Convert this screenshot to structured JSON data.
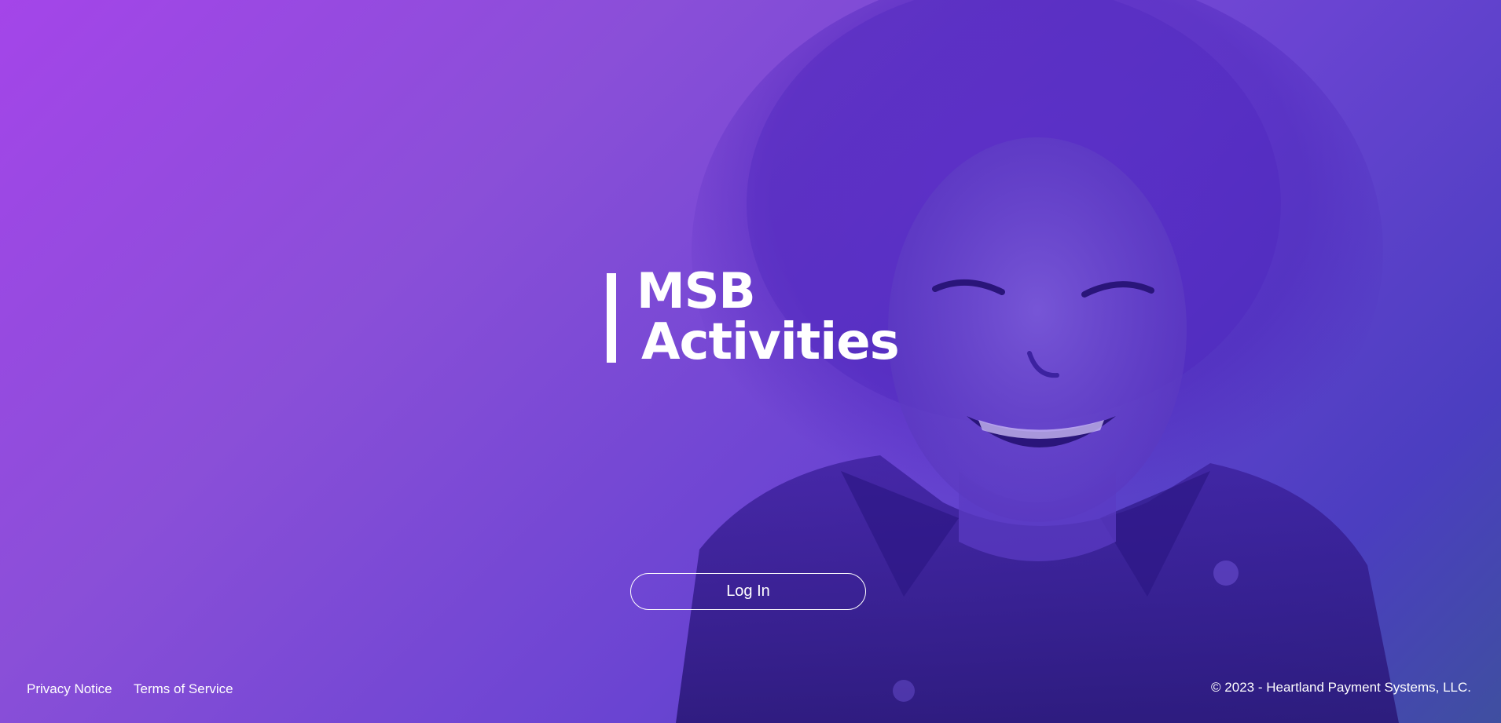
{
  "logo": {
    "line1": "MSB",
    "line2": "Activities"
  },
  "login_button": {
    "label": "Log In"
  },
  "footer": {
    "links": [
      {
        "label": "Privacy Notice"
      },
      {
        "label": "Terms of Service"
      }
    ],
    "copyright": "© 2023 - Heartland Payment Systems, LLC."
  },
  "colors": {
    "gradient_start": "#a445e9",
    "gradient_end": "#3f4fa0",
    "text": "#ffffff"
  },
  "hero_image": "smiling-child-photo"
}
